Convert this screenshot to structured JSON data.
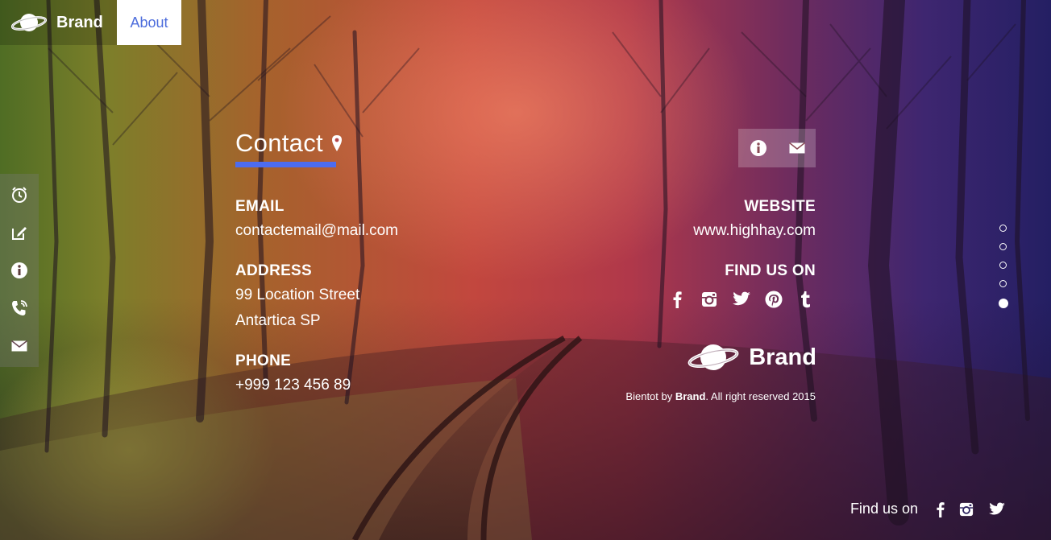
{
  "nav": {
    "brand": "Brand",
    "about": "About"
  },
  "sidebar": {
    "items": [
      {
        "icon": "alarm-icon"
      },
      {
        "icon": "edit-icon"
      },
      {
        "icon": "info-icon"
      },
      {
        "icon": "phone-icon"
      },
      {
        "icon": "mail-icon"
      }
    ]
  },
  "contact": {
    "title": "Contact",
    "email_label": "EMAIL",
    "email_value": "contactemail@mail.com",
    "address_label": "ADDRESS",
    "address_line1": "99 Location Street",
    "address_line2": "Antartica SP",
    "phone_label": "PHONE",
    "phone_value": "+999 123 456 89",
    "website_label": "WEBSITE",
    "website_value": "www.highhay.com",
    "findus_label": "FIND US ON",
    "social": [
      "facebook-icon",
      "instagram-icon",
      "twitter-icon",
      "pinterest-icon",
      "tumblr-icon"
    ]
  },
  "footer": {
    "brand": "Brand",
    "copyright_prefix": "Bientot by ",
    "copyright_brand": "Brand",
    "copyright_suffix": ". All right reserved 2015"
  },
  "pagination": {
    "count": 5,
    "active": 5
  },
  "bottom": {
    "findus": "Find us on"
  },
  "colors": {
    "accent": "#4c6cf0",
    "about_text": "#4d6ddc"
  }
}
